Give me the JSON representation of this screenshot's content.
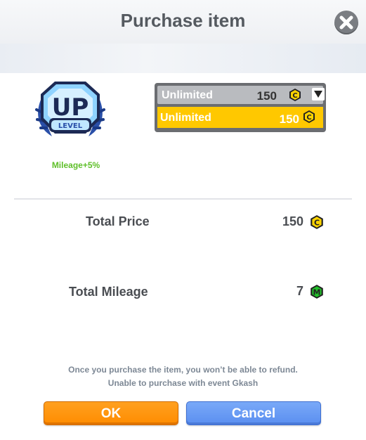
{
  "dialog": {
    "title": "Purchase item",
    "close_icon": "close-icon"
  },
  "item": {
    "badge_icon": "level-up-badge-icon",
    "badge_main_text": "UP",
    "badge_sub_text": "LEVEL",
    "mileage_bonus": "Mileage+5%"
  },
  "duration_select": {
    "selected_label": "Unlimited",
    "selected_price": "150",
    "options": [
      {
        "label": "Unlimited",
        "price": "150"
      }
    ],
    "currency_icon": "cash-coin-icon",
    "arrow_icon": "chevron-down-icon",
    "highlight_color": "#ffc800"
  },
  "totals": {
    "price_label": "Total Price",
    "price_value": "150",
    "price_icon": "cash-coin-icon",
    "mileage_label": "Total Mileage",
    "mileage_value": "7",
    "mileage_icon": "mileage-coin-icon"
  },
  "notice": {
    "line1": "Once you purchase the item, you won’t be able to refund.",
    "line2": "Unable to purchase with event Gkash"
  },
  "buttons": {
    "ok_label": "OK",
    "cancel_label": "Cancel",
    "ok_color": "#ff9610",
    "cancel_color": "#6a9cf4"
  }
}
